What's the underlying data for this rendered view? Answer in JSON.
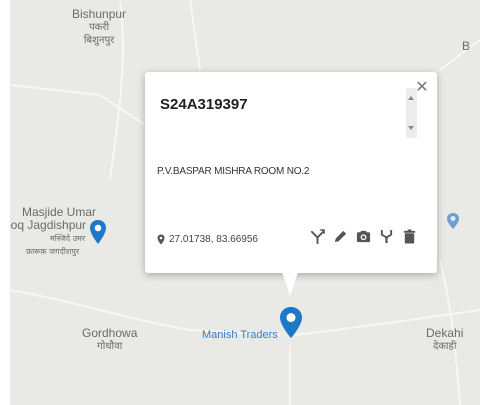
{
  "map": {
    "places": {
      "top": {
        "name_en": "Bishunpur",
        "name_dev1": "पकरी",
        "name_dev2": "बिशुनपुर"
      },
      "masjid": {
        "line1": "Masjide Umar",
        "line2": "rooq Jagdishpur",
        "dev1": "मस्जिदे उमर",
        "dev2": "फ़ारूक़ जगदीशपुर"
      },
      "gordhowa": {
        "name_en": "Gordhowa",
        "name_dev": "गोधौवा"
      },
      "manish": {
        "name": "Manish Traders"
      },
      "dekahi": {
        "name_en": "Dekahi",
        "name_dev": "देकाही"
      },
      "edge_right": {
        "label": "B"
      }
    },
    "colors": {
      "background": "#e9e9e6",
      "road": "#ffffff",
      "pin": "#1e78c8",
      "label": "#6a6a6a",
      "poi_label": "#3b7bc0"
    }
  },
  "popup": {
    "title": "S24A319397",
    "address": "P.V.BASPAR MISHRA ROOM NO.2",
    "coordinates": "27.01738, 83.66956",
    "close_icon": "close-icon",
    "actions": [
      {
        "icon": "directions-icon"
      },
      {
        "icon": "edit-icon"
      },
      {
        "icon": "camera-icon"
      },
      {
        "icon": "tools-icon"
      },
      {
        "icon": "trash-icon"
      }
    ]
  }
}
